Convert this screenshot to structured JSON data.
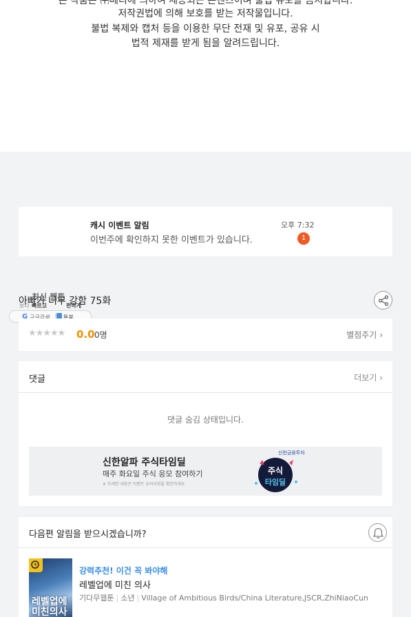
{
  "copyright_notice": {
    "line1": "본 작품은 ㈜베리에 의하여 제공되는 콘텐츠이며 불법 유포를 금지합니다.",
    "line2": "저작권법에 의해 보호를 받는 저작물입니다.",
    "line3": "불법 복제와 캡처 등을 이용한 무단 전재 및 유포, 공유 시",
    "line4": "법적 제재를 받게 됨을 알려드립니다."
  },
  "cash_event": {
    "title": "캐시 이벤트 알림",
    "message": "이번주에 확인하지 못한 이벤트가 있습니다.",
    "time": "오후 7:32",
    "badge_count": "1"
  },
  "episode": {
    "title": "아빠가 너무 강함 75화"
  },
  "overlay": {
    "text_a": "최신 웹툰",
    "text_b": "보다",
    "text_c": "빠르고",
    "text_d": "편하게",
    "search_label": "구글검색",
    "toonbook_label": "툰북"
  },
  "rating": {
    "stars": "★★★★★",
    "score": "0.0",
    "count": "0명",
    "rate_link": "별점주기"
  },
  "comments": {
    "label": "댓글",
    "more_link": "더보기",
    "hidden_message": "댓글 숨김 상태입니다."
  },
  "ad": {
    "title": "신한알파 주식타임딜",
    "subtitle": "매주 화요일 주식 응모 참여하기",
    "fine_print": "※ 자세한 내용은 이벤트 유의사항을 확인하세요",
    "brand": "신한금융투자",
    "graphic_text_top": "주식",
    "graphic_text_bottom": "타임딜"
  },
  "next_episode_notify": {
    "label": "다음편 알림을 받으시겠습니까?"
  },
  "recommendation": {
    "tag": "강력추천! 이건 꼭 봐야해",
    "title": "레벨업에 미친 의사",
    "meta_platform": "기다무웹툰",
    "meta_genre": "소년",
    "meta_authors": "Village of Ambitious Birds/China Literature,JSCR,ZhiNiaoCun",
    "thumb_text": "레벨업에 미친의사"
  },
  "colors": {
    "accent_orange": "#f29100",
    "badge_red": "#ee5a24",
    "link_blue": "#3a8ee6"
  }
}
